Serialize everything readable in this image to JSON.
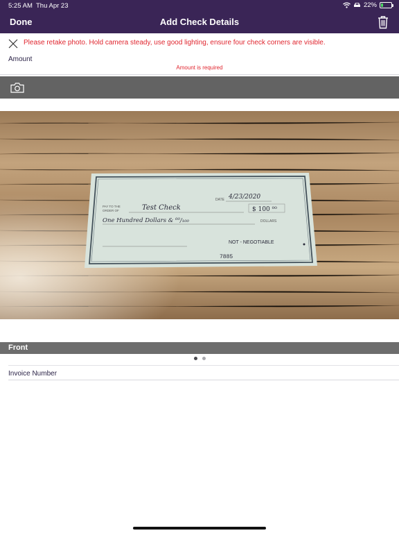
{
  "status_bar": {
    "time": "5:25 AM",
    "date": "Thu Apr 23",
    "battery": "22%",
    "battery_level": 0.22
  },
  "nav": {
    "done_label": "Done",
    "title": "Add Check Details"
  },
  "error_banner": {
    "message": "Please retake photo. Hold camera steady, use good lighting, ensure four check corners are visible."
  },
  "amount_field": {
    "label": "Amount",
    "value": "",
    "error": "Amount is required"
  },
  "check_image": {
    "date": "4/23/2020",
    "payee": "Test Check",
    "amount": "$ 100 ⁰⁰",
    "written_amount": "One Hundred Dollars & ⁰⁰/₁₀₀",
    "negotiable": "NOT - NEGOTIABLE",
    "check_number": "7885",
    "pay_to": "PAY TO THE",
    "order_of": "ORDER OF",
    "date_label": "DATE",
    "dollars": "DOLLARS"
  },
  "side_label": "Front",
  "pager": {
    "count": 2,
    "active": 0
  },
  "invoice_field": {
    "label": "Invoice Number",
    "value": ""
  },
  "colors": {
    "nav": "#3a2556",
    "error": "#e0262f",
    "camera_bar": "#636363",
    "front_bar": "#6d6d6d"
  }
}
